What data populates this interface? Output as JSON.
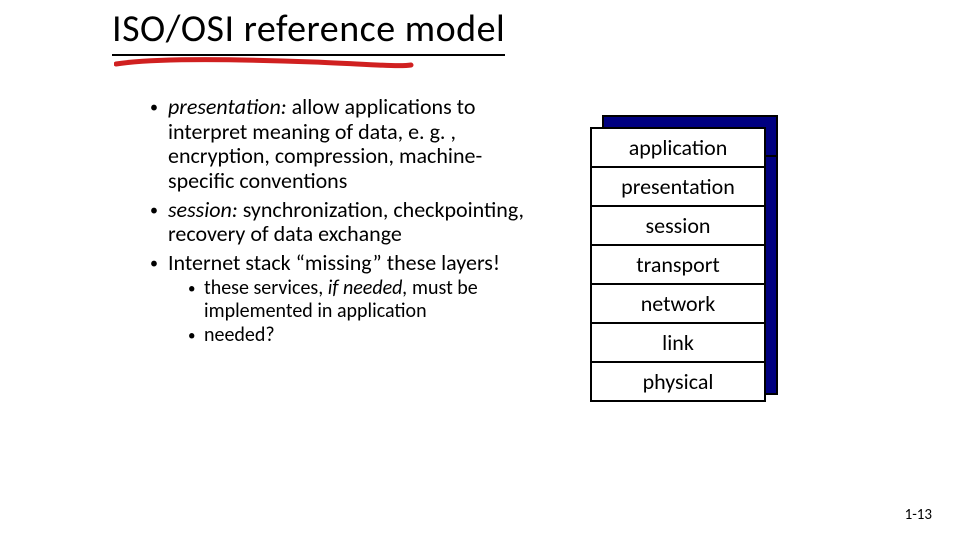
{
  "title": "ISO/OSI reference model",
  "bullets": {
    "b1_label": "presentation:",
    "b1_rest": " allow applications to interpret meaning of data, e. g. , encryption, compression, machine-specific conventions",
    "b2_label": "session:",
    "b2_rest": " synchronization, checkpointing, recovery of data exchange",
    "b3_pre": "Internet stack ",
    "b3_quote": "“missing”",
    "b3_post": " these layers!",
    "sub1_pre": "these services, ",
    "sub1_em": "if needed,",
    "sub1_post": " must be implemented in application",
    "sub2": "needed?"
  },
  "layers": {
    "l1": "application",
    "l2": "presentation",
    "l3": "session",
    "l4": "transport",
    "l5": "network",
    "l6": "link",
    "l7": "physical"
  },
  "pagenum": "1-13",
  "colors": {
    "shadow": "#000080",
    "red": "#D02020"
  }
}
